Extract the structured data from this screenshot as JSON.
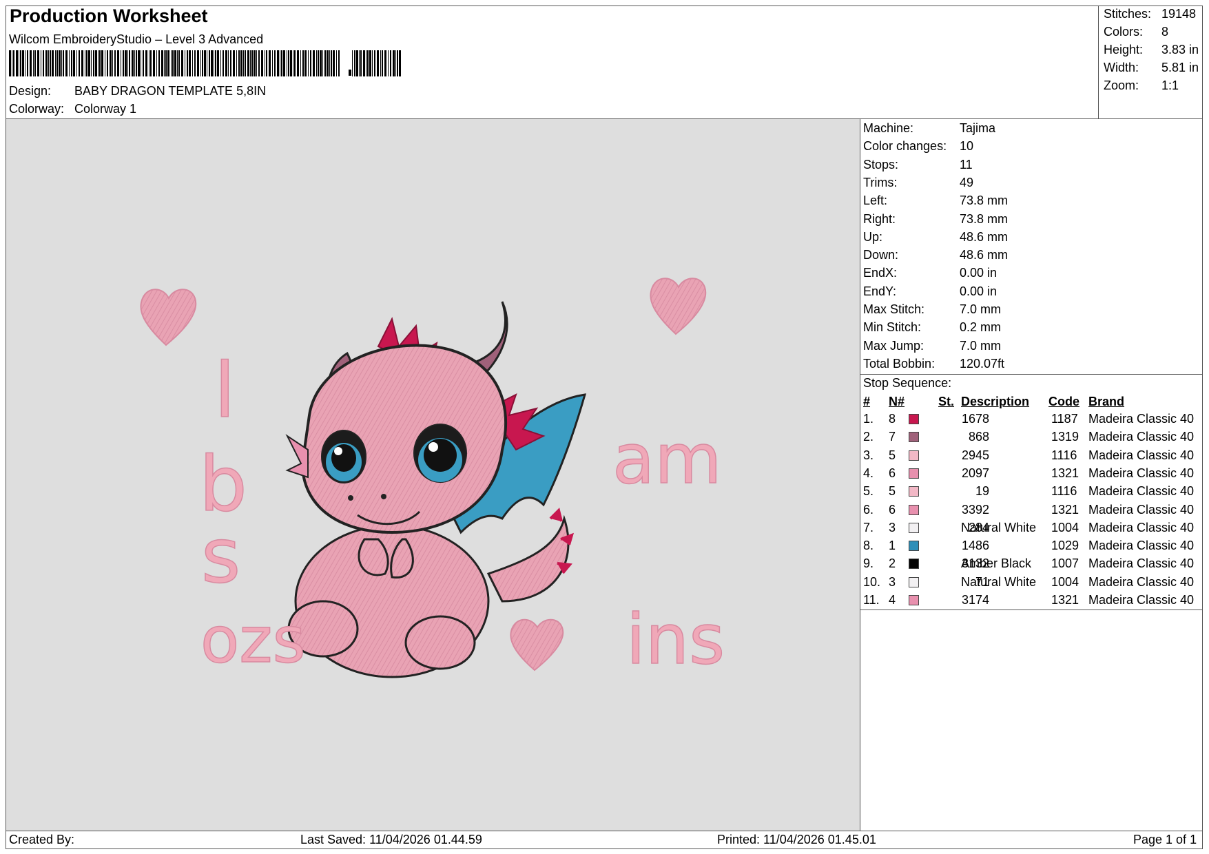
{
  "header": {
    "title": "Production Worksheet",
    "subtitle": "Wilcom EmbroideryStudio – Level 3 Advanced",
    "design_label": "Design:",
    "design_value": "BABY DRAGON TEMPLATE 5,8IN",
    "colorway_label": "Colorway:",
    "colorway_value": "Colorway 1"
  },
  "stats": [
    {
      "label": "Stitches:",
      "value": "19148"
    },
    {
      "label": "Colors:",
      "value": "8"
    },
    {
      "label": "Height:",
      "value": "3.83 in"
    },
    {
      "label": "Width:",
      "value": "5.81 in"
    },
    {
      "label": "Zoom:",
      "value": "1:1"
    }
  ],
  "machine_info": [
    {
      "label": "Machine:",
      "value": "Tajima"
    },
    {
      "label": "Color changes:",
      "value": "10"
    },
    {
      "label": "Stops:",
      "value": "11"
    },
    {
      "label": "Trims:",
      "value": "49"
    },
    {
      "label": "Left:",
      "value": "73.8 mm"
    },
    {
      "label": "Right:",
      "value": "73.8 mm"
    },
    {
      "label": "Up:",
      "value": "48.6 mm"
    },
    {
      "label": "Down:",
      "value": "48.6 mm"
    },
    {
      "label": "EndX:",
      "value": "0.00 in"
    },
    {
      "label": "EndY:",
      "value": "0.00 in"
    },
    {
      "label": "Max Stitch:",
      "value": "7.0 mm"
    },
    {
      "label": "Min Stitch:",
      "value": "0.2 mm"
    },
    {
      "label": "Max Jump:",
      "value": "7.0 mm"
    },
    {
      "label": "Total Bobbin:",
      "value": "120.07ft"
    }
  ],
  "stop_sequence": {
    "title": "Stop Sequence:",
    "headers": {
      "num": "#",
      "n": "N#",
      "st": "St.",
      "description": "Description",
      "code": "Code",
      "brand": "Brand"
    },
    "rows": [
      {
        "num": "1.",
        "n": "8",
        "color": "#c8174f",
        "st": "1678",
        "description": "",
        "code": "1187",
        "brand": "Madeira Classic 40"
      },
      {
        "num": "2.",
        "n": "7",
        "color": "#a0617a",
        "st": "868",
        "description": "",
        "code": "1319",
        "brand": "Madeira Classic 40"
      },
      {
        "num": "3.",
        "n": "5",
        "color": "#f2b8c6",
        "st": "2945",
        "description": "",
        "code": "1116",
        "brand": "Madeira Classic 40"
      },
      {
        "num": "4.",
        "n": "6",
        "color": "#e890ae",
        "st": "2097",
        "description": "",
        "code": "1321",
        "brand": "Madeira Classic 40"
      },
      {
        "num": "5.",
        "n": "5",
        "color": "#f2b8c6",
        "st": "19",
        "description": "",
        "code": "1116",
        "brand": "Madeira Classic 40"
      },
      {
        "num": "6.",
        "n": "6",
        "color": "#e890ae",
        "st": "3392",
        "description": "",
        "code": "1321",
        "brand": "Madeira Classic 40"
      },
      {
        "num": "7.",
        "n": "3",
        "color": "#f2f0f2",
        "st": "284",
        "description": "Natural White",
        "code": "1004",
        "brand": "Madeira Classic 40"
      },
      {
        "num": "8.",
        "n": "1",
        "color": "#2f8fb8",
        "st": "1486",
        "description": "",
        "code": "1029",
        "brand": "Madeira Classic 40"
      },
      {
        "num": "9.",
        "n": "2",
        "color": "#050505",
        "st": "3132",
        "description": "Amber Black",
        "code": "1007",
        "brand": "Madeira Classic 40"
      },
      {
        "num": "10.",
        "n": "3",
        "color": "#f2f0f2",
        "st": "71",
        "description": "Natural White",
        "code": "1004",
        "brand": "Madeira Classic 40"
      },
      {
        "num": "11.",
        "n": "4",
        "color": "#e890ae",
        "st": "3174",
        "description": "",
        "code": "1321",
        "brand": "Madeira Classic 40"
      }
    ]
  },
  "design_text": {
    "l": "l",
    "b": "b",
    "s": "s",
    "ozs": "ozs",
    "am": "am",
    "ins": "ins"
  },
  "footer": {
    "created_by": "Created By:",
    "last_saved": "Last Saved: 11/04/2026 01.44.59",
    "printed": "Printed: 11/04/2026 01.45.01",
    "page": "Page 1 of 1"
  }
}
